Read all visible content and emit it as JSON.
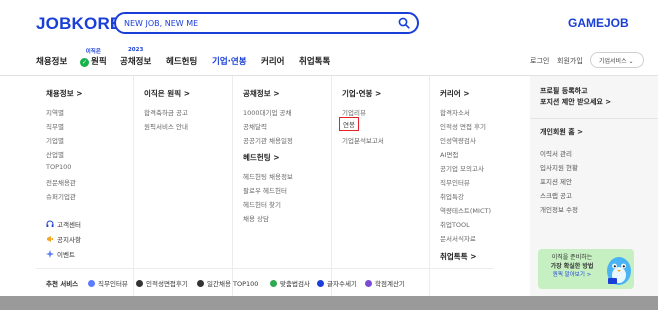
{
  "header": {
    "logo": {
      "main": "JOBKOREA",
      "mark": "."
    },
    "search": {
      "value": "NEW JOB, NEW ME"
    },
    "gamejob": "GAMEJOB"
  },
  "gnb": {
    "items": [
      {
        "label": "채용정보",
        "sup": ""
      },
      {
        "label": "원픽",
        "sup": "이직은"
      },
      {
        "label": "공채정보",
        "sup": "2023"
      },
      {
        "label": "헤드헌팅",
        "sup": ""
      },
      {
        "label": "기업·연봉",
        "sup": ""
      },
      {
        "label": "커리어",
        "sup": ""
      },
      {
        "label": "취업톡톡",
        "sup": ""
      }
    ],
    "login": "로그인",
    "signup": "회원가입",
    "corp_service": "기업서비스",
    "corp_arrow": "⌄"
  },
  "columns": [
    {
      "title": "채용정보 >",
      "links": [
        "지역별",
        "직무별",
        "기업별",
        "산업별",
        "TOP100",
        "전문채용관",
        "슈퍼기업관"
      ]
    },
    {
      "title": "이직은 원픽 >",
      "links": [
        "합격축하금 공고",
        "원픽서비스 안내"
      ]
    },
    {
      "title": "공채정보 >",
      "links": [
        "1000대기업 공채",
        "공채달력",
        "공공기관 채용일정"
      ],
      "title2": "헤드헌팅 >",
      "links2": [
        "헤드헌팅 채용정보",
        "팔로우 헤드헌터",
        "헤드헌터 찾기",
        "채용 상담"
      ]
    },
    {
      "title": "기업·연봉 >",
      "links": [
        "기업리뷰",
        "연봉",
        "기업분석보고서"
      ]
    },
    {
      "title": "커리어 >",
      "links": [
        "합격자소서",
        "인적성 면접 후기",
        "인성역량검사",
        "AI면접",
        "공기업 모의고사",
        "직무인터뷰",
        "취업특강",
        "역량테스트(MICT)",
        "취업TOOL",
        "문서서식자료"
      ],
      "title2": "취업톡톡 >"
    }
  ],
  "side": {
    "promo_line1": "프로필 등록하고",
    "promo_line2": "포지션 제안 받으세요 >",
    "personal_title": "개인회원 홈 >",
    "links": [
      "이력서 관리",
      "입사지원 현황",
      "포지션 제안",
      "스크랩 공고",
      "개인정보 수정"
    ],
    "banner": {
      "line1": "이직을 준비하는",
      "line2": "가장 확실한 방법",
      "line3": "원픽 알아보기 >"
    }
  },
  "cs": [
    {
      "label": "고객센터",
      "icon": "headset-icon"
    },
    {
      "label": "공지사항",
      "icon": "megaphone-icon"
    },
    {
      "label": "이벤트",
      "icon": "sparkle-icon"
    }
  ],
  "recommend": {
    "label": "추천 서비스",
    "items": [
      {
        "label": "직무인터뷰",
        "color": "#5b7cff"
      },
      {
        "label": "인적성면접후기",
        "color": "#333333"
      },
      {
        "label": "일간채용 TOP100",
        "color": "#333333"
      },
      {
        "label": "맞춤법검사",
        "color": "#2fa84f"
      },
      {
        "label": "글자수세기",
        "color": "#1a3fd8"
      },
      {
        "label": "학점계산기",
        "color": "#7a4bd6"
      }
    ]
  },
  "colors": {
    "brand": "#1a3fd8",
    "highlight": "#e8202a",
    "banner_bg": "#c6f0c1"
  }
}
